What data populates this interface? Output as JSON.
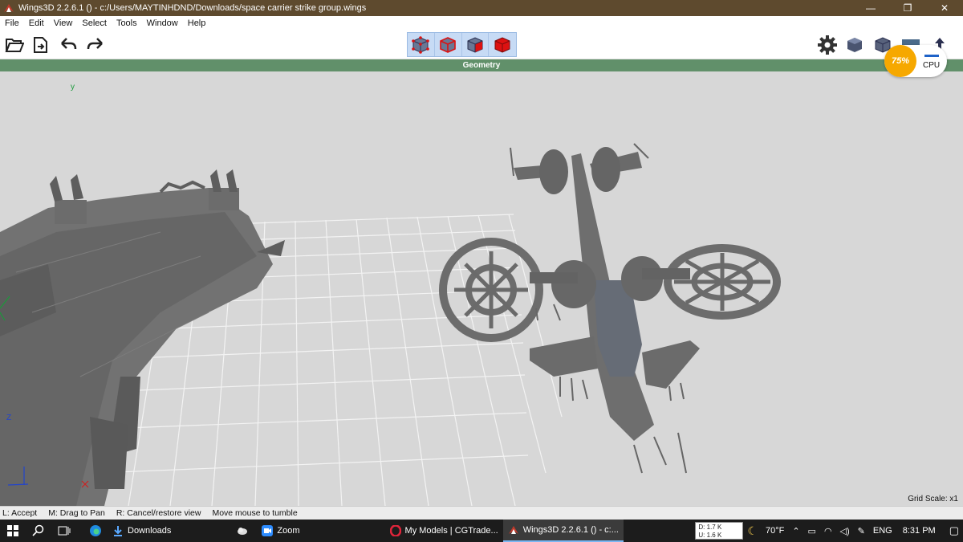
{
  "window": {
    "title": "Wings3D 2.2.6.1 () - c:/Users/MAYTINHDND/Downloads/space carrier strike group.wings",
    "minimize_glyph": "—",
    "maximize_glyph": "❐",
    "close_glyph": "✕"
  },
  "menu": [
    "File",
    "Edit",
    "View",
    "Select",
    "Tools",
    "Window",
    "Help"
  ],
  "toolbar": {
    "left_icons": [
      "open-folder-icon",
      "save-icon",
      "undo-icon",
      "redo-icon"
    ],
    "selection_modes": [
      "vertex-select-icon",
      "edge-select-icon",
      "face-select-icon",
      "object-select-icon"
    ],
    "right_icons": [
      "gear-icon",
      "cube-icon",
      "cube-icon",
      "screen-icon",
      "upload-icon"
    ]
  },
  "geometry_tab": "Geometry",
  "viewport": {
    "axis_y": "y",
    "axis_z": "Z",
    "grid_scale": "Grid Scale: x1",
    "bg_color": "#d7d7d7"
  },
  "status": {
    "items": [
      "L: Accept",
      "M: Drag to Pan",
      "R: Cancel/restore view",
      "Move mouse to tumble"
    ]
  },
  "cpu_widget": {
    "percent": "75%",
    "label": "CPU"
  },
  "taskbar": {
    "apps": [
      {
        "label": "Downloads",
        "icon": "download-icon"
      },
      {
        "label": "",
        "icon": "cloud-icon"
      },
      {
        "label": "Zoom",
        "icon": "zoom-icon"
      },
      {
        "label": "My Models | CGTrade...",
        "icon": "opera-icon"
      },
      {
        "label": "Wings3D 2.2.6.1 () - c:...",
        "icon": "wings-icon"
      }
    ],
    "net_down": "D: 1.7 K",
    "net_up": "U: 1.6 K",
    "weather": "70°F",
    "language": "ENG",
    "time": "8:31 PM"
  }
}
